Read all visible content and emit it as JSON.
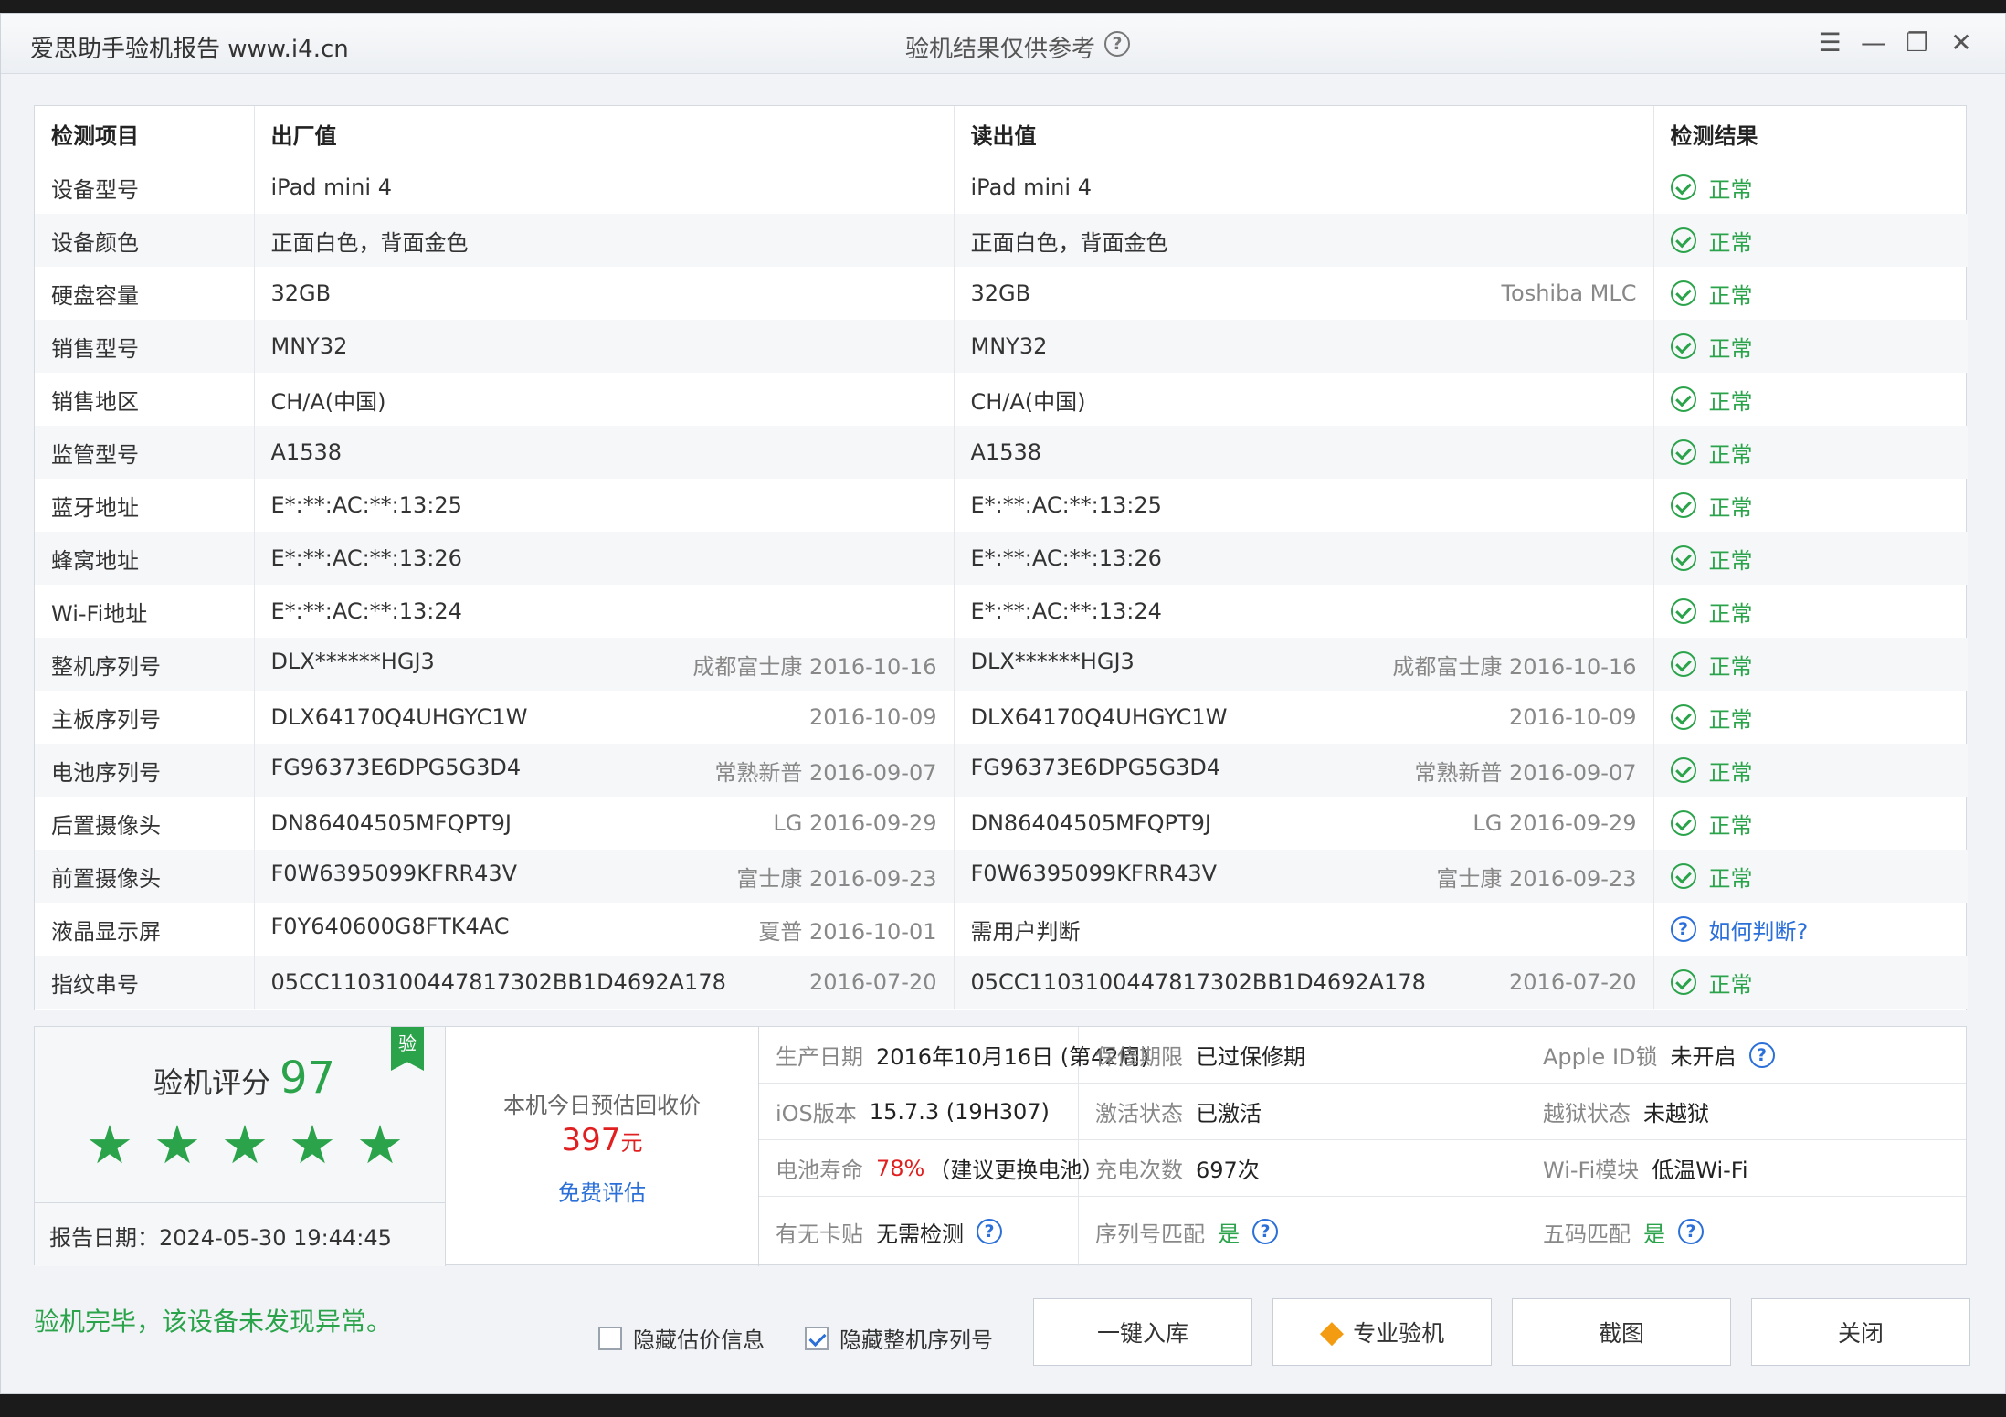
{
  "titlebar": {
    "app_title": "爱思助手验机报告 www.i4.cn",
    "center_title": "验机结果仅供参考",
    "help": "?",
    "menu_icon": "☰",
    "min_icon": "—",
    "restore_icon": "❐",
    "close_icon": "✕"
  },
  "table": {
    "headers": [
      "检测项目",
      "出厂值",
      "读出值",
      "检测结果"
    ],
    "rows": [
      {
        "item": "设备型号",
        "factory": "iPad mini 4",
        "factory_note": "",
        "read": "iPad mini 4",
        "read_note": "",
        "result": "正常",
        "status": "ok"
      },
      {
        "item": "设备颜色",
        "factory": "正面白色，背面金色",
        "factory_note": "",
        "read": "正面白色，背面金色",
        "read_note": "",
        "result": "正常",
        "status": "ok"
      },
      {
        "item": "硬盘容量",
        "factory": "32GB",
        "factory_note": "",
        "read": "32GB",
        "read_note": "Toshiba MLC",
        "result": "正常",
        "status": "ok"
      },
      {
        "item": "销售型号",
        "factory": "MNY32",
        "factory_note": "",
        "read": "MNY32",
        "read_note": "",
        "result": "正常",
        "status": "ok"
      },
      {
        "item": "销售地区",
        "factory": "CH/A(中国)",
        "factory_note": "",
        "read": "CH/A(中国)",
        "read_note": "",
        "result": "正常",
        "status": "ok"
      },
      {
        "item": "监管型号",
        "factory": "A1538",
        "factory_note": "",
        "read": "A1538",
        "read_note": "",
        "result": "正常",
        "status": "ok"
      },
      {
        "item": "蓝牙地址",
        "factory": "E*:**:AC:**:13:25",
        "factory_note": "",
        "read": "E*:**:AC:**:13:25",
        "read_note": "",
        "result": "正常",
        "status": "ok"
      },
      {
        "item": "蜂窝地址",
        "factory": "E*:**:AC:**:13:26",
        "factory_note": "",
        "read": "E*:**:AC:**:13:26",
        "read_note": "",
        "result": "正常",
        "status": "ok"
      },
      {
        "item": "Wi-Fi地址",
        "factory": "E*:**:AC:**:13:24",
        "factory_note": "",
        "read": "E*:**:AC:**:13:24",
        "read_note": "",
        "result": "正常",
        "status": "ok"
      },
      {
        "item": "整机序列号",
        "factory": "DLX******HGJ3",
        "factory_note": "成都富士康 2016-10-16",
        "read": "DLX******HGJ3",
        "read_note": "成都富士康 2016-10-16",
        "result": "正常",
        "status": "ok"
      },
      {
        "item": "主板序列号",
        "factory": "DLX64170Q4UHGYC1W",
        "factory_note": "2016-10-09",
        "read": "DLX64170Q4UHGYC1W",
        "read_note": "2016-10-09",
        "result": "正常",
        "status": "ok"
      },
      {
        "item": "电池序列号",
        "factory": "FG96373E6DPG5G3D4",
        "factory_note": "常熟新普 2016-09-07",
        "read": "FG96373E6DPG5G3D4",
        "read_note": "常熟新普 2016-09-07",
        "result": "正常",
        "status": "ok"
      },
      {
        "item": "后置摄像头",
        "factory": "DN86404505MFQPT9J",
        "factory_note": "LG 2016-09-29",
        "read": "DN86404505MFQPT9J",
        "read_note": "LG 2016-09-29",
        "result": "正常",
        "status": "ok"
      },
      {
        "item": "前置摄像头",
        "factory": "F0W6395099KFRR43V",
        "factory_note": "富士康 2016-09-23",
        "read": "F0W6395099KFRR43V",
        "read_note": "富士康 2016-09-23",
        "result": "正常",
        "status": "ok"
      },
      {
        "item": "液晶显示屏",
        "factory": "F0Y640600G8FTK4AC",
        "factory_note": "夏普 2016-10-01",
        "read": "需用户判断",
        "read_note": "",
        "result": "如何判断?",
        "status": "ask"
      },
      {
        "item": "指纹串号",
        "factory": "05CC1103100447817302BB1D4692A178",
        "factory_note": "2016-07-20",
        "read": "05CC1103100447817302BB1D4692A178",
        "read_note": "2016-07-20",
        "result": "正常",
        "status": "ok"
      }
    ]
  },
  "score": {
    "label": "验机评分",
    "value": "97",
    "badge": "验",
    "stars": 5,
    "report_date": "报告日期：2024-05-30 19:44:45"
  },
  "price": {
    "label": "本机今日预估回收价",
    "value": "397",
    "unit": "元",
    "eval_link": "免费评估"
  },
  "info": {
    "production_date": {
      "k": "生产日期",
      "v": "2016年10月16日 (第42周)"
    },
    "warranty": {
      "k": "保修期限",
      "v": "已过保修期"
    },
    "apple_id": {
      "k": "Apple ID锁",
      "v": "未开启"
    },
    "ios": {
      "k": "iOS版本",
      "v": "15.7.3 (19H307)"
    },
    "activation": {
      "k": "激活状态",
      "v": "已激活"
    },
    "jailbreak": {
      "k": "越狱状态",
      "v": "未越狱"
    },
    "battery": {
      "k": "电池寿命",
      "v": "78%",
      "v2": "（建议更换电池）"
    },
    "charge_count": {
      "k": "充电次数",
      "v": "697次"
    },
    "wifi": {
      "k": "Wi-Fi模块",
      "v": "低温Wi-Fi"
    },
    "sim_sticker": {
      "k": "有无卡贴",
      "v": "无需检测"
    },
    "serial_match": {
      "k": "序列号匹配",
      "v": "是"
    },
    "five_code": {
      "k": "五码匹配",
      "v": "是"
    }
  },
  "footer": {
    "status": "验机完毕，该设备未发现异常。",
    "hide_price_label": "隐藏估价信息",
    "hide_price_checked": false,
    "hide_serial_label": "隐藏整机序列号",
    "hide_serial_checked": true,
    "btn_stock": "一键入库",
    "btn_pro": "专业验机",
    "btn_screenshot": "截图",
    "btn_close": "关闭"
  },
  "colors": {
    "ok": "#2aa34a",
    "link": "#2b6fd8",
    "price": "#e02020"
  }
}
